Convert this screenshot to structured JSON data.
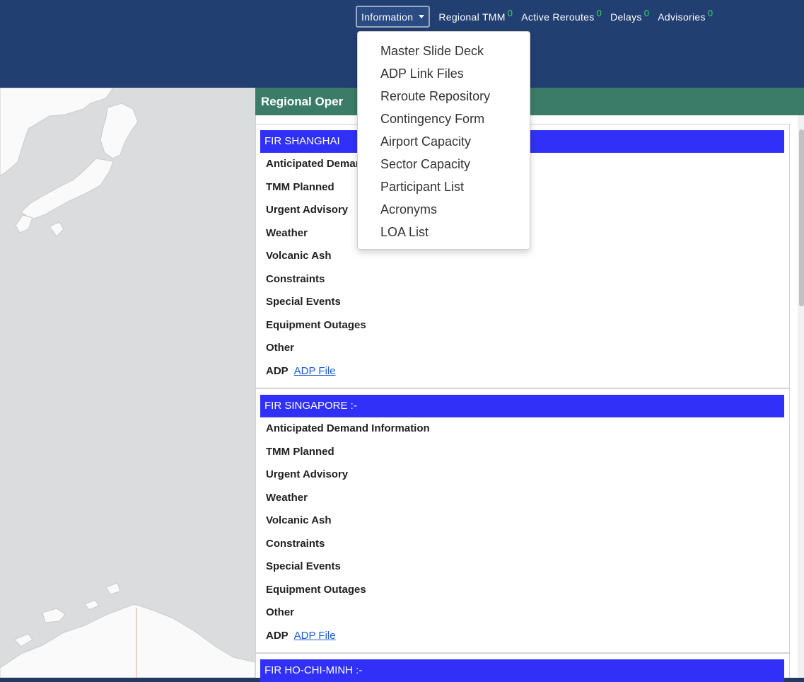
{
  "nav": {
    "dropdown_label": "Information",
    "links": [
      {
        "label": "Regional TMM",
        "count": "0"
      },
      {
        "label": "Active Reroutes",
        "count": "0"
      },
      {
        "label": "Delays",
        "count": "0"
      },
      {
        "label": "Advisories",
        "count": "0"
      }
    ],
    "menu_items": [
      "Master Slide Deck",
      "ADP Link Files",
      "Reroute Repository",
      "Contingency Form",
      "Airport Capacity",
      "Sector Capacity",
      "Participant List",
      "Acronyms",
      "LOA List"
    ]
  },
  "panel": {
    "title": "Regional Oper",
    "firs": [
      {
        "title": "FIR SHANGHAI",
        "rows": [
          "Anticipated Demand Information",
          "TMM Planned",
          "Urgent Advisory",
          "Weather",
          "Volcanic Ash",
          "Constraints",
          "Special Events",
          "Equipment Outages",
          "Other"
        ],
        "adp_label": "ADP",
        "adp_link": "ADP File"
      },
      {
        "title": "FIR SINGAPORE :-",
        "rows": [
          "Anticipated Demand Information",
          "TMM Planned",
          "Urgent Advisory",
          "Weather",
          "Volcanic Ash",
          "Constraints",
          "Special Events",
          "Equipment Outages",
          "Other"
        ],
        "adp_label": "ADP",
        "adp_link": "ADP File"
      },
      {
        "title": "FIR HO-CHI-MINH :-"
      }
    ]
  },
  "colors": {
    "nav_bg": "#223f72",
    "panel_header": "#3b7c68",
    "fir_title_bg": "#3030f8",
    "badge": "#33dd55",
    "link": "#1a5cd8"
  }
}
